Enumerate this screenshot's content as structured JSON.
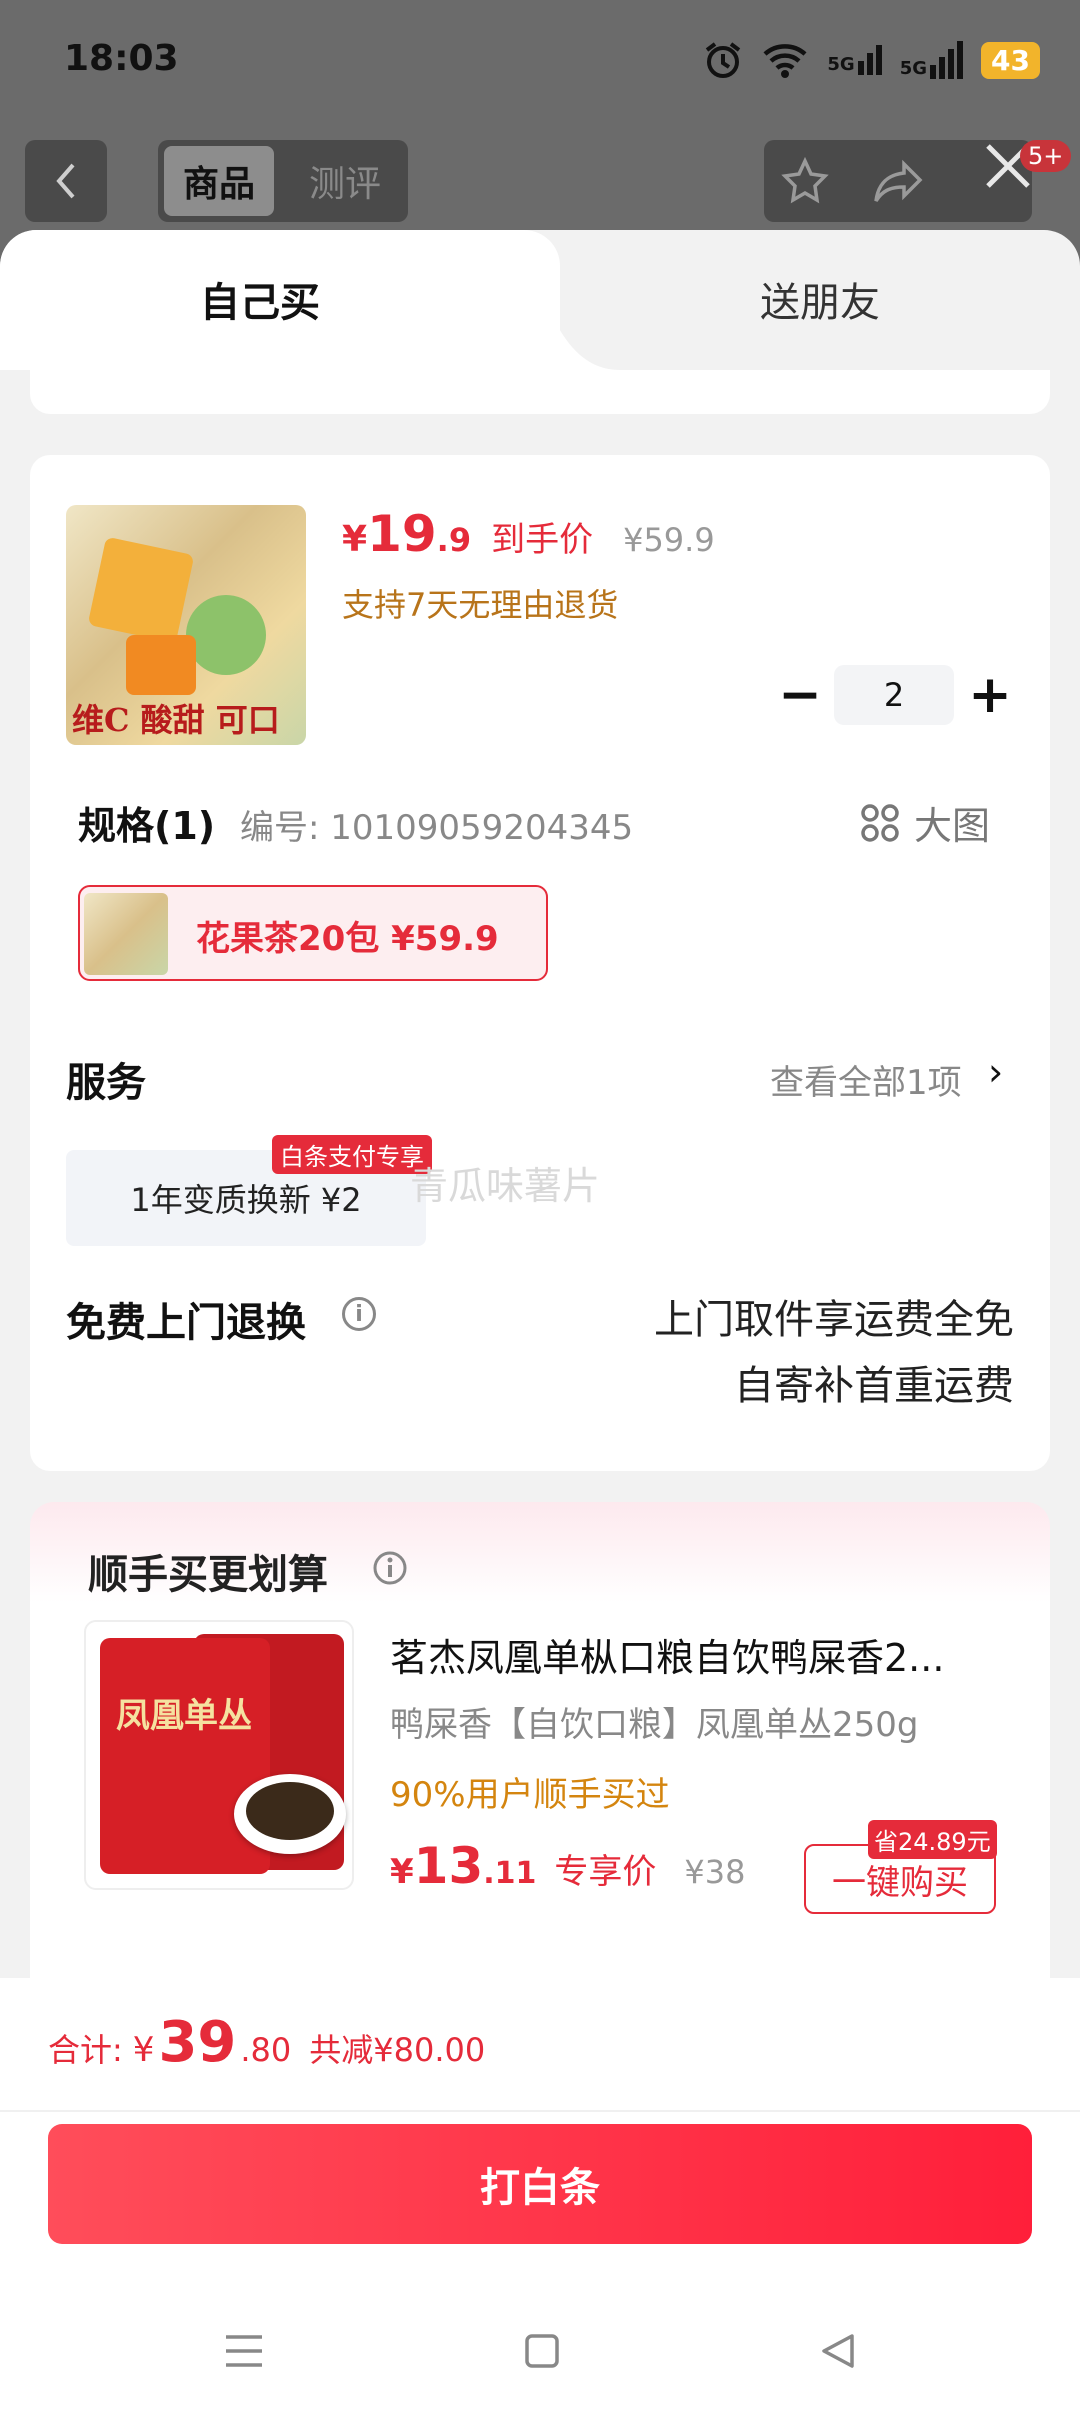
{
  "status": {
    "time": "18:03",
    "battery": "43",
    "net1": "5G",
    "net2": "5G"
  },
  "nav": {
    "tab_goods": "商品",
    "tab_review": "测评",
    "badge": "5+"
  },
  "sheet": {
    "tab_self": "自己买",
    "tab_friend": "送朋友"
  },
  "product": {
    "thumb_text": "维C 酸甜 可口",
    "currency": "¥",
    "price_int": "19",
    "price_dec": ".9",
    "price_tag": "到手价",
    "orig_price": "¥59.9",
    "return_policy": "支持7天无理由退货",
    "quantity": "2"
  },
  "spec": {
    "title": "规格(1)",
    "code": "编号: 10109059204345",
    "big_image": "大图",
    "option": "花果茶20包  ¥59.9"
  },
  "service": {
    "title": "服务",
    "view_all": "查看全部1项",
    "item": "1年变质换新  ¥2",
    "item_badge": "白条支付专享",
    "watermark": "青瓜味薯片"
  },
  "free_return": {
    "title": "免费上门退换",
    "line1": "上门取件享运费全免",
    "line2": "自寄补首重运费"
  },
  "addon": {
    "title": "顺手买更划算",
    "image_text": "凤凰单丛",
    "name": "茗杰凤凰单枞口粮自饮鸭屎香2...",
    "sku": "鸭屎香【自饮口粮】凤凰单丛250g",
    "hot": "90%用户顺手买过",
    "currency": "¥",
    "price_int": "13",
    "price_dec": ".11",
    "price_tag": "专享价",
    "orig_price": "¥38",
    "buy_label": "一键购买",
    "save_badge": "省24.89元"
  },
  "footer": {
    "total_label": "合计:",
    "currency": "¥",
    "total_int": "39",
    "total_dec": ".80",
    "total_save": "共减¥80.00",
    "pay_label": "打白条"
  },
  "colors": {
    "accent": "#e52b3a",
    "gold": "#b8741a",
    "hot": "#d4850f"
  }
}
